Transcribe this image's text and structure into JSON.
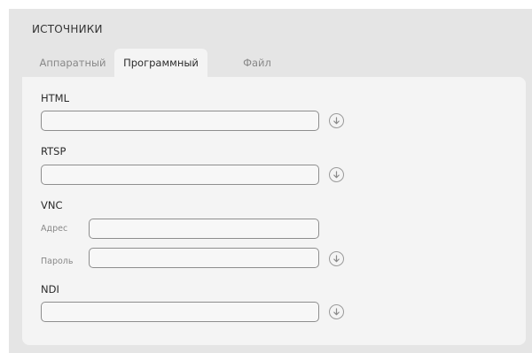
{
  "section_title": "ИСТОЧНИКИ",
  "tabs": [
    {
      "label": "Аппаратный",
      "active": false
    },
    {
      "label": "Программный",
      "active": true
    },
    {
      "label": "Файл",
      "active": false
    }
  ],
  "groups": {
    "html": {
      "label": "HTML",
      "value": ""
    },
    "rtsp": {
      "label": "RTSP",
      "value": ""
    },
    "vnc": {
      "label": "VNC",
      "address_label": "Адрес",
      "address_value": "",
      "password_label": "Пароль",
      "password_value": ""
    },
    "ndi": {
      "label": "NDI",
      "value": ""
    }
  },
  "icons": {
    "download": "download-circle-icon"
  },
  "colors": {
    "panel_bg": "#e5e5e5",
    "content_bg": "#f4f4f4",
    "border": "#8e8e8e"
  }
}
